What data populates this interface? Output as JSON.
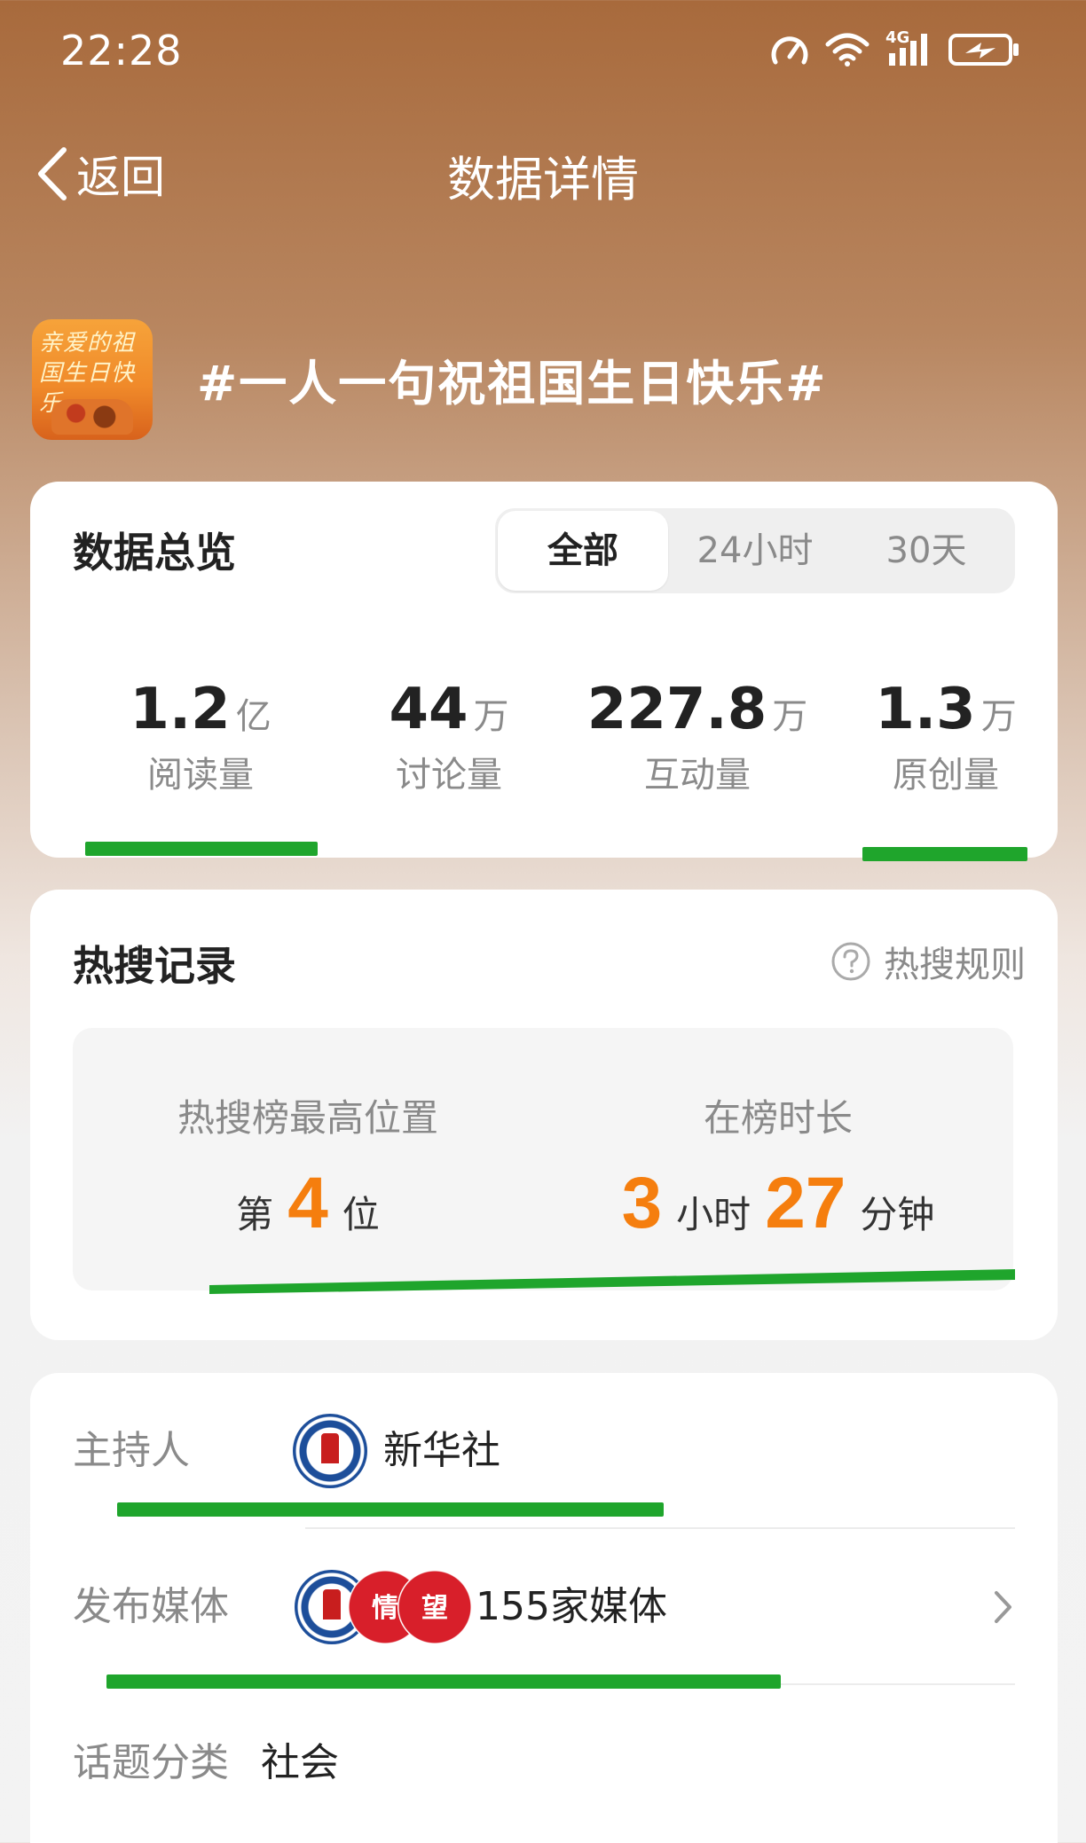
{
  "status": {
    "time": "22:28",
    "network": "4G"
  },
  "nav": {
    "back_label": "返回",
    "title": "数据详情"
  },
  "topic": {
    "title": "#一人一句祝祖国生日快乐#",
    "thumb_text": "亲爱的祖国生日快乐"
  },
  "overview": {
    "heading": "数据总览",
    "tabs": [
      "全部",
      "24小时",
      "30天"
    ],
    "active_tab": "全部",
    "stats": [
      {
        "value": "1.2",
        "unit": "亿",
        "label": "阅读量"
      },
      {
        "value": "44",
        "unit": "万",
        "label": "讨论量"
      },
      {
        "value": "227.8",
        "unit": "万",
        "label": "互动量"
      },
      {
        "value": "1.3",
        "unit": "万",
        "label": "原创量"
      }
    ]
  },
  "hot_search": {
    "heading": "热搜记录",
    "rule_label": "热搜规则",
    "peak": {
      "label": "热搜榜最高位置",
      "prefix": "第",
      "value": "4",
      "suffix": "位"
    },
    "duration": {
      "label": "在榜时长",
      "hours": "3",
      "hours_unit": "小时",
      "minutes": "27",
      "minutes_unit": "分钟"
    }
  },
  "info": {
    "host": {
      "label": "主持人",
      "value": "新华社"
    },
    "media": {
      "label": "发布媒体",
      "value": "155家媒体"
    },
    "category": {
      "label": "话题分类",
      "value": "社会"
    }
  },
  "colors": {
    "accent_orange": "#f57e0e",
    "mark_green": "#1fa52c"
  }
}
